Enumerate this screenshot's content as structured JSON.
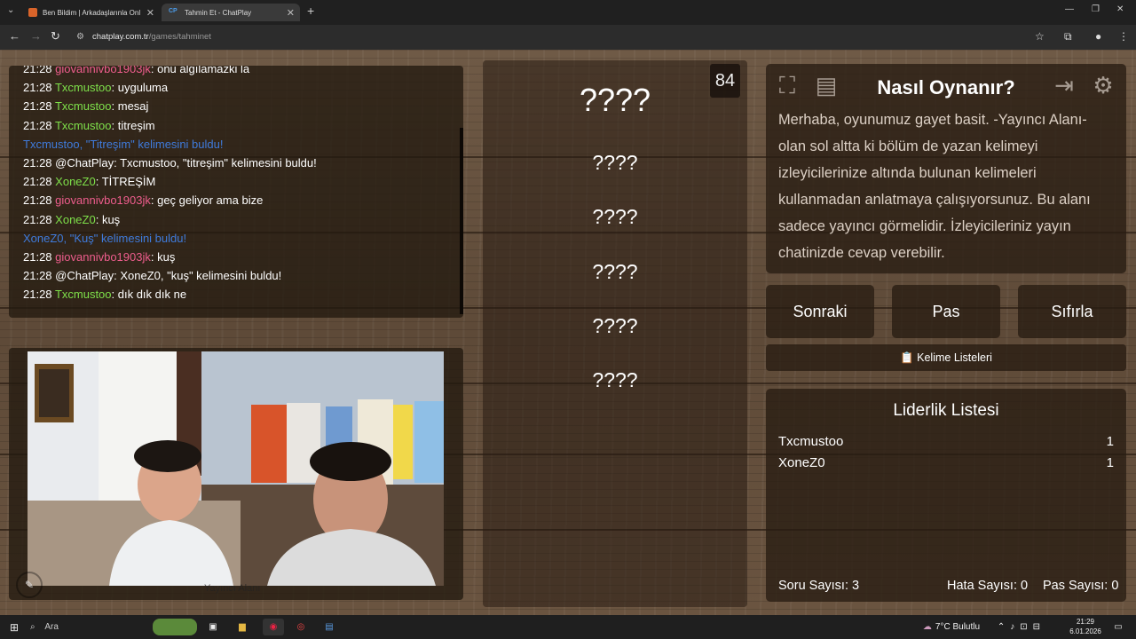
{
  "browser": {
    "tabs": [
      {
        "title": "Ben Bildim | Arkadaşlarınla Onl",
        "active": false
      },
      {
        "title": "Tahmin Et - ChatPlay",
        "active": true
      }
    ],
    "url_host": "chatplay.com.tr",
    "url_path": "/games/tahminet"
  },
  "chat": {
    "messages": [
      {
        "time": "21:28",
        "user": "giovannivbo1903jk",
        "user_color": "pink",
        "text": ": onu algılamazki la"
      },
      {
        "time": "21:28",
        "user": "Txcmustoo",
        "user_color": "green",
        "text": ": uyguluma"
      },
      {
        "time": "21:28",
        "user": "Txcmustoo",
        "user_color": "green",
        "text": ": mesaj"
      },
      {
        "time": "21:28",
        "user": "Txcmustoo",
        "user_color": "green",
        "text": ": titreşim"
      },
      {
        "system": "Txcmustoo, \"Titreşim\" kelimesini buldu!"
      },
      {
        "time": "21:28",
        "user": "",
        "user_color": "white",
        "text": "@ChatPlay: Txcmustoo, \"titreşim\" kelimesini buldu!"
      },
      {
        "time": "21:28",
        "user": "XoneZ0",
        "user_color": "green",
        "text": ": TİTREŞİM"
      },
      {
        "time": "21:28",
        "user": "giovannivbo1903jk",
        "user_color": "pink",
        "text": ": geç geliyor ama bize"
      },
      {
        "time": "21:28",
        "user": "XoneZ0",
        "user_color": "green",
        "text": ": kuş"
      },
      {
        "system": "XoneZ0, \"Kuş\" kelimesini buldu!"
      },
      {
        "time": "21:28",
        "user": "giovannivbo1903jk",
        "user_color": "pink",
        "text": ": kuş"
      },
      {
        "time": "21:28",
        "user": "",
        "user_color": "white",
        "text": "@ChatPlay: XoneZ0, \"kuş\" kelimesini buldu!"
      },
      {
        "time": "21:28",
        "user": "Txcmustoo",
        "user_color": "green",
        "text": ": dık dık dık ne"
      }
    ]
  },
  "streamer": {
    "label": "Yayıncı Alanı"
  },
  "game": {
    "timer": "84",
    "words": [
      "????",
      "????",
      "????",
      "????",
      "????",
      "????"
    ]
  },
  "howto": {
    "title": "Nasıl Oynanır?",
    "text": "Merhaba, oyunumuz gayet basit. -Yayıncı Alanı- olan sol altta ki bölüm de yazan kelimeyi izleyicilerinize altında bulunan kelimeleri kullanmadan anlatmaya çalışıyorsunuz. Bu alanı sadece yayıncı görmelidir. İzleyicileriniz yayın chatinizde cevap verebilir."
  },
  "controls": {
    "next": "Sonraki",
    "pass": "Pas",
    "reset": "Sıfırla",
    "lists": "Kelime Listeleri"
  },
  "leaderboard": {
    "title": "Liderlik Listesi",
    "rows": [
      {
        "name": "Txcmustoo",
        "score": "1"
      },
      {
        "name": "XoneZ0",
        "score": "1"
      }
    ],
    "stats": {
      "questions": "Soru Sayısı: 3",
      "errors": "Hata Sayısı: 0",
      "passes": "Pas Sayısı: 0"
    }
  },
  "taskbar": {
    "search": "Ara",
    "weather": "7°C Bulutlu",
    "time": "21:29",
    "date": "6.01.2026"
  },
  "colors": {
    "user_green": "#7ee04a",
    "user_pink": "#ee5d8d",
    "system_blue": "#3f7bdc",
    "panel": "#2a1c12"
  }
}
